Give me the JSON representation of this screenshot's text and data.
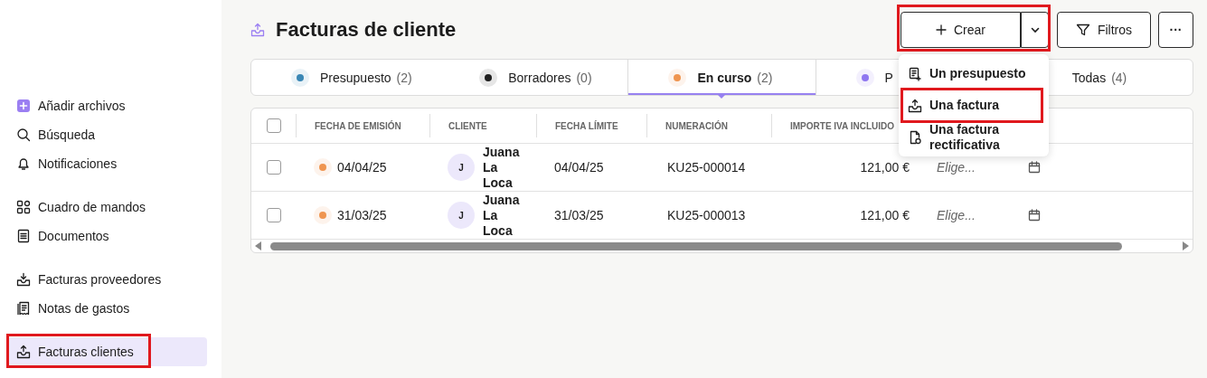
{
  "sidebar": {
    "groups": [
      {
        "items": [
          {
            "label": "Añadir archivos",
            "kind": "add",
            "selected": false,
            "highlighted": false
          },
          {
            "label": "Búsqueda",
            "kind": "search",
            "selected": false,
            "highlighted": false
          },
          {
            "label": "Notificaciones",
            "kind": "bell",
            "selected": false,
            "highlighted": false
          }
        ]
      },
      {
        "items": [
          {
            "label": "Cuadro de mandos",
            "kind": "grid",
            "selected": false,
            "highlighted": false
          },
          {
            "label": "Documentos",
            "kind": "document",
            "selected": false,
            "highlighted": false
          }
        ]
      },
      {
        "items": [
          {
            "label": "Facturas proveedores",
            "kind": "download",
            "selected": false,
            "highlighted": false
          },
          {
            "label": "Notas de gastos",
            "kind": "receipt",
            "selected": false,
            "highlighted": false
          }
        ]
      },
      {
        "items": [
          {
            "label": "Facturas clientes",
            "kind": "upload",
            "selected": true,
            "highlighted": true
          }
        ]
      }
    ]
  },
  "header": {
    "title": "Facturas de cliente",
    "create_button": {
      "label": "Crear",
      "highlighted": true
    },
    "filter_button": {
      "label": "Filtros"
    },
    "more_button": {
      "label": "···"
    }
  },
  "create_menu": {
    "items": [
      {
        "label": "Un presupuesto",
        "kind": "quote",
        "highlighted": false
      },
      {
        "label": "Una factura",
        "kind": "upload",
        "highlighted": true
      },
      {
        "label": "Una factura rectificativa",
        "kind": "correction",
        "highlighted": false
      }
    ]
  },
  "tabs": [
    {
      "label": "Presupuesto",
      "count": "(2)",
      "color": "#3a87b5",
      "selected": false
    },
    {
      "label": "Borradores",
      "count": "(0)",
      "color": "#1f1f1f",
      "selected": false
    },
    {
      "label": "En curso",
      "count": "(2)",
      "color": "#ef9550",
      "selected": true
    },
    {
      "label": "P",
      "color": "#8f77f0",
      "selected": false
    },
    {
      "label": "Todas",
      "count": "(4)",
      "selected": false
    }
  ],
  "table": {
    "select_all": {
      "checked": false
    },
    "columns": [
      "FECHA DE EMISIÓN",
      "CLIENTE",
      "FECHA LÍMITE",
      "NUMERACIÓN",
      "IMPORTE IVA INCLUIDO"
    ],
    "rows": [
      {
        "checked": false,
        "color": "#ef9550",
        "issue_date": "04/04/25",
        "client_initial": "J",
        "client": "Juana La Loca",
        "due_date": "04/04/25",
        "number": "KU25-000014",
        "amount": "121,00 €",
        "column_7": {
          "placeholder": "Elige..."
        }
      },
      {
        "checked": false,
        "color": "#ef9550",
        "issue_date": "31/03/25",
        "client_initial": "J",
        "client": "Juana La Loca",
        "due_date": "31/03/25",
        "number": "KU25-000013",
        "amount": "121,00 €",
        "column_7": {
          "placeholder": "Elige..."
        }
      }
    ]
  }
}
